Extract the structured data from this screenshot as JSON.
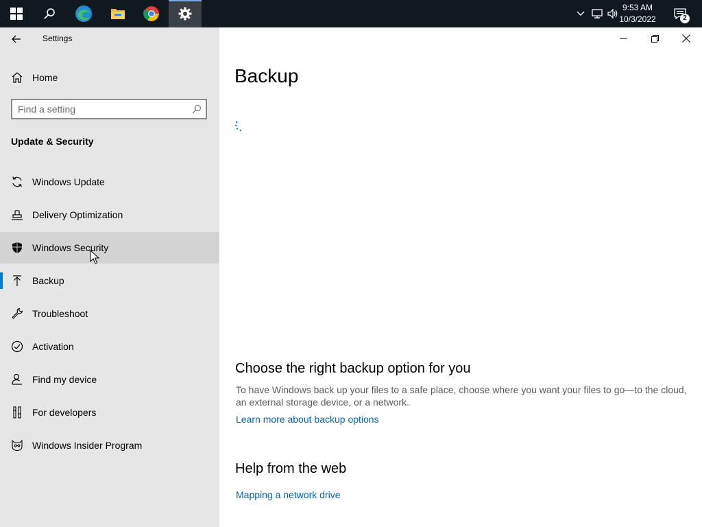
{
  "taskbar": {
    "clock_time": "9:53 AM",
    "clock_date": "10/3/2022",
    "notification_count": "2",
    "pinned": [
      "start-icon",
      "search-icon",
      "edge-icon",
      "file-explorer-icon",
      "chrome-icon",
      "settings-icon"
    ],
    "active_app": "settings-icon"
  },
  "window": {
    "title": "Settings"
  },
  "sidebar": {
    "home_label": "Home",
    "search_placeholder": "Find a setting",
    "section_title": "Update & Security",
    "items": [
      {
        "label": "Windows Update",
        "icon": "sync-icon"
      },
      {
        "label": "Delivery Optimization",
        "icon": "delivery-optimization-icon"
      },
      {
        "label": "Windows Security",
        "icon": "shield-icon"
      },
      {
        "label": "Backup",
        "icon": "backup-arrow-icon"
      },
      {
        "label": "Troubleshoot",
        "icon": "wrench-icon"
      },
      {
        "label": "Activation",
        "icon": "check-circle-icon"
      },
      {
        "label": "Find my device",
        "icon": "person-location-icon"
      },
      {
        "label": "For developers",
        "icon": "developer-tools-icon"
      },
      {
        "label": "Windows Insider Program",
        "icon": "insider-cat-icon"
      }
    ],
    "hovered_item": "Windows Security",
    "selected_item": "Backup"
  },
  "main": {
    "title": "Backup",
    "choose_heading": "Choose the right backup option for you",
    "choose_description": "To have Windows back up your files to a safe place, choose where you want your files to go—to the cloud, an external storage device, or a network.",
    "learn_more_link": "Learn more about backup options",
    "help_heading": "Help from the web",
    "help_link": "Mapping a network drive"
  },
  "colors": {
    "accent": "#0078d7",
    "link": "#0067b8",
    "sidebar_bg": "#e6e6e6",
    "taskbar_bg": "#101820"
  }
}
